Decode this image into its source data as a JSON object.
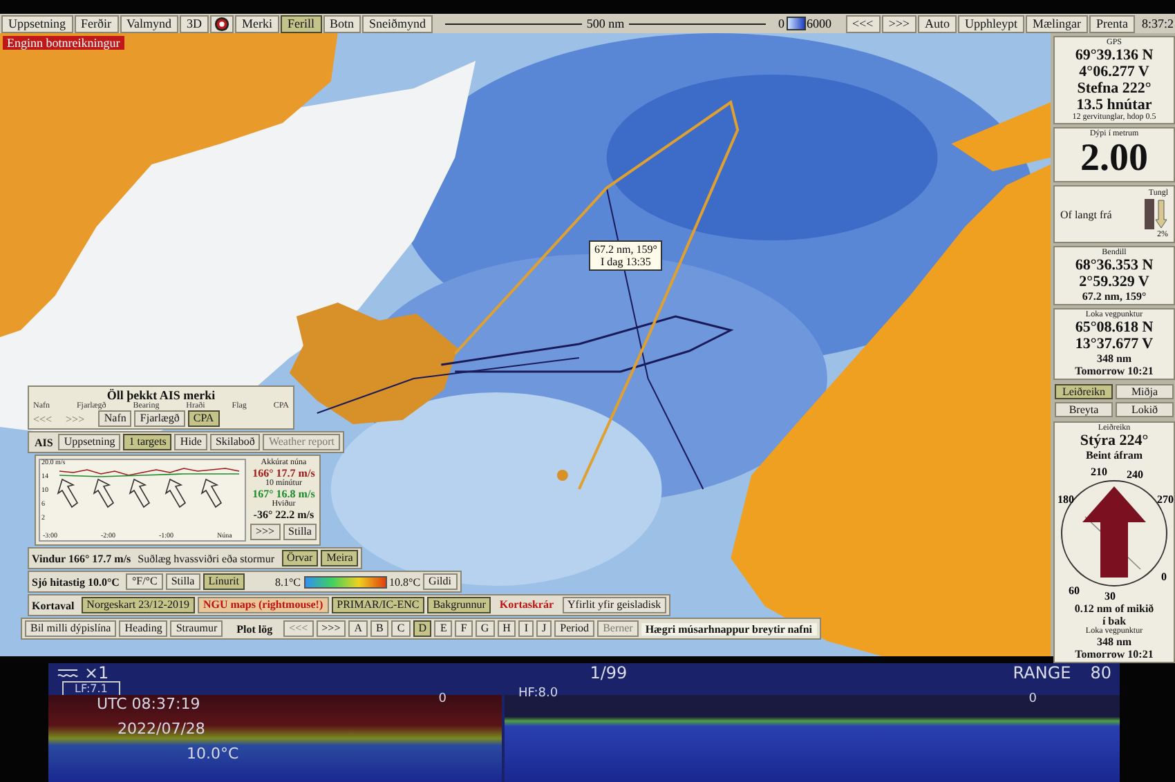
{
  "toolbar": {
    "buttons": [
      {
        "kind": "text",
        "label": "Uppsetning",
        "selected": false
      },
      {
        "kind": "text",
        "label": "Ferðir",
        "selected": false
      },
      {
        "kind": "text",
        "label": "Valmynd",
        "selected": false
      },
      {
        "kind": "text",
        "label": "3D",
        "selected": false
      },
      {
        "kind": "icon",
        "selected": false
      },
      {
        "kind": "text",
        "label": "Merki",
        "selected": false
      },
      {
        "kind": "text",
        "label": "Ferill",
        "selected": true
      },
      {
        "kind": "text",
        "label": "Botn",
        "selected": false
      },
      {
        "kind": "text",
        "label": "Sneiðmynd",
        "selected": false
      }
    ],
    "scale": "500 nm",
    "depth_min": "0",
    "depth_max": "6000",
    "nav_buttons": [
      "<<<",
      ">>>"
    ],
    "right_buttons": [
      "Auto",
      "Upphleypt",
      "Mælingar",
      "Prenta"
    ],
    "clock": "8:37:2"
  },
  "map": {
    "status": "Enginn botnreikningur",
    "tooltip": {
      "distance": "67.2 nm, 159°",
      "time": "I dag 13:35"
    }
  },
  "ais": {
    "title": "Öll þekkt AIS merki",
    "columns": [
      "Nafn",
      "Fjarlægð",
      "Bearing",
      "Hraði",
      "Flag",
      "CPA"
    ],
    "pager": [
      "<<<",
      ">>>"
    ],
    "sort_buttons": [
      {
        "label": "Nafn",
        "selected": false
      },
      {
        "label": "Fjarlægð",
        "selected": false
      },
      {
        "label": "CPA",
        "selected": true
      }
    ]
  },
  "tabs": {
    "label": "AIS",
    "items": [
      {
        "label": "Uppsetning",
        "selected": false,
        "disabled": false
      },
      {
        "label": "1 targets",
        "selected": true,
        "disabled": false
      },
      {
        "label": "Hide",
        "selected": false,
        "disabled": false
      },
      {
        "label": "Skilaboð",
        "selected": false,
        "disabled": false
      },
      {
        "label": "Weather report",
        "selected": false,
        "disabled": true
      }
    ]
  },
  "wind": {
    "y_labels": [
      "20.0 m/s",
      "14",
      "10",
      "6",
      "2"
    ],
    "x_labels": [
      "-3:00",
      "-2:00",
      "-1:00",
      "Núna"
    ],
    "readings": [
      {
        "label": "Akkúrat núna",
        "value": "166° 17.7 m/s",
        "color": "#a01818"
      },
      {
        "label": "10 mínútur",
        "value": "167° 16.8 m/s",
        "color": "#1a8a2a"
      },
      {
        "label": "Hviður",
        "value": "-36° 22.2 m/s",
        "color": "#111111"
      }
    ],
    "buttons": [
      ">>>",
      "Stilla"
    ],
    "summary": "Vindur 166° 17.7 m/s",
    "description": "Suðlæg hvassviðri eða stormur",
    "summary_buttons": [
      "Örvar",
      "Meira"
    ]
  },
  "sea_temp": {
    "label": "Sjó hitastig 10.0°C",
    "buttons": [
      {
        "label": "°F/°C",
        "selected": false
      },
      {
        "label": "Stilla",
        "selected": false
      },
      {
        "label": "Línurit",
        "selected": true
      }
    ],
    "min": "8.1°C",
    "max": "10.8°C",
    "button": "Gildi"
  },
  "chart_selection": {
    "label": "Kortaval",
    "items": [
      {
        "kind": "button",
        "label": "Norgeskart 23/12-2019",
        "selected": true
      },
      {
        "kind": "alert",
        "label": "NGU maps (rightmouse!)",
        "selected": true
      },
      {
        "kind": "button",
        "label": "PRIMAR/IC-ENC",
        "selected": true
      },
      {
        "kind": "button",
        "label": "Bakgrunnur",
        "selected": true
      },
      {
        "kind": "alert",
        "label": "Kortaskrár",
        "selected": false
      },
      {
        "kind": "button",
        "label": "Yfirlit yfir geisladisk",
        "selected": false
      }
    ]
  },
  "plot": {
    "buttons": [
      "Bil milli dýpislína",
      "Heading",
      "Straumur"
    ],
    "label": "Plot lög",
    "pager": [
      {
        "label": "<<<",
        "disabled": true
      },
      {
        "label": ">>>",
        "disabled": false
      }
    ],
    "layers": [
      {
        "label": "A",
        "selected": false
      },
      {
        "label": "B",
        "selected": false
      },
      {
        "label": "C",
        "selected": false
      },
      {
        "label": "D",
        "selected": true
      },
      {
        "label": "E",
        "selected": false
      },
      {
        "label": "F",
        "selected": false
      },
      {
        "label": "G",
        "selected": false
      },
      {
        "label": "H",
        "selected": false
      },
      {
        "label": "I",
        "selected": false
      },
      {
        "label": "J",
        "selected": false
      }
    ],
    "period": "Period",
    "berner": "Berner",
    "hint": "Hægri músarhnappur breytir nafni"
  },
  "side": {
    "gps": {
      "title": "GPS",
      "lat": "69°39.136 N",
      "lon": "4°06.277 V",
      "heading": "Stefna 222°",
      "speed": "13.5 hnútar",
      "info": "12 gervitunglar, hdop 0.5"
    },
    "depth": {
      "title": "Dýpi í metrum",
      "value": "2.00"
    },
    "tide": {
      "text": "Of langt frá",
      "title": "Tungl",
      "percent": "2%"
    },
    "cursor": {
      "title": "Bendill",
      "lat": "68°36.353 N",
      "lon": "2°59.329 V",
      "info": "67.2 nm, 159°"
    },
    "waypoint": {
      "title": "Loka vegpunktur",
      "lat": "65°08.618 N",
      "lon": "13°37.677 V",
      "distance": "348 nm",
      "eta": "Tomorrow 10:21"
    },
    "buttons": [
      {
        "label": "Leiðreikn",
        "selected": true
      },
      {
        "label": "Miðja",
        "selected": false
      },
      {
        "label": "Breyta",
        "selected": false
      },
      {
        "label": "Lokið",
        "selected": false
      }
    ],
    "steer": {
      "title": "Leiðreikn",
      "command": "Stýra 224°",
      "sub": "Beint áfram",
      "compass": [
        "180",
        "210",
        "240",
        "270",
        "0",
        "30",
        "60"
      ],
      "offset": "0.12 nm of mikið í bak",
      "final_title": "Loka vegpunktur",
      "final_distance": "348 nm",
      "final_eta": "Tomorrow 10:21"
    }
  },
  "sonar": {
    "zoom": "×1",
    "page": "1/99",
    "range_label": "RANGE",
    "range": "80",
    "lf": "LF:7.1",
    "lf_zero": "0",
    "utc": "UTC 08:37:19",
    "date": "2022/07/28",
    "temp": "10.0°C",
    "hf": "HF:8.0",
    "hf_zero": "0"
  }
}
